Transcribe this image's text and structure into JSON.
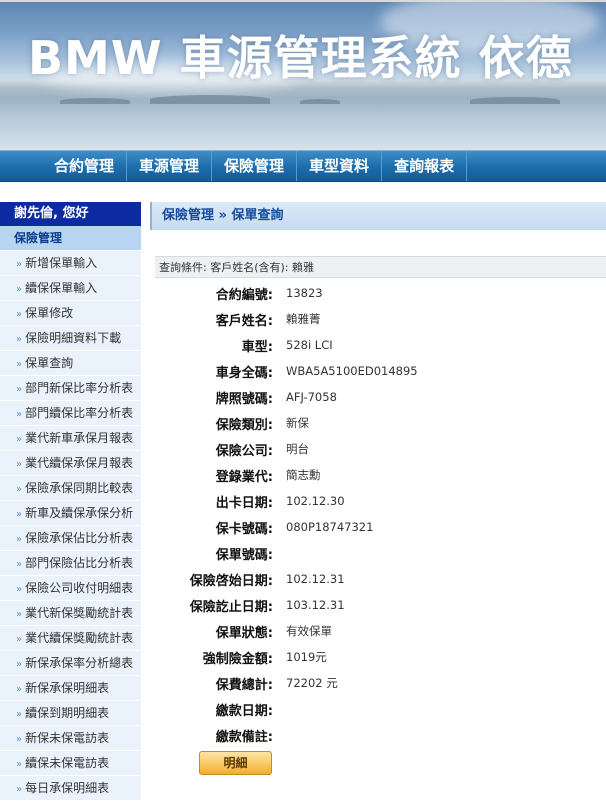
{
  "banner": {
    "title": "BMW 車源管理系統 依德"
  },
  "nav": {
    "items": [
      "合約管理",
      "車源管理",
      "保險管理",
      "車型資料",
      "查詢報表"
    ]
  },
  "sidebar": {
    "greeting": "謝先倫, 您好",
    "section": "保險管理",
    "items": [
      "新增保單輸入",
      "續保保單輸入",
      "保單修改",
      "保險明細資料下載",
      "保單查詢",
      "部門新保比率分析表",
      "部門續保比率分析表",
      "業代新車承保月報表",
      "業代續保承保月報表",
      "保險承保同期比較表",
      "新車及續保承保分析",
      "保險承保佔比分析表",
      "部門保險佔比分析表",
      "保險公司收付明細表",
      "業代新保獎勵統計表",
      "業代續保獎勵統計表",
      "新保承保率分析總表",
      "新保承保明細表",
      "續保到期明細表",
      "新保未保電訪表",
      "續保未保電訪表",
      "每日承保明細表"
    ]
  },
  "content": {
    "breadcrumb": "保險管理 » 保單查詢",
    "query": "查詢條件:  客戶姓名(含有): 賴雅",
    "fields": [
      {
        "label": "合約編號:",
        "value": "13823"
      },
      {
        "label": "客戶姓名:",
        "value": "賴雅菁"
      },
      {
        "label": "車型:",
        "value": "528i LCI"
      },
      {
        "label": "車身全碼:",
        "value": "WBA5A5100ED014895"
      },
      {
        "label": "牌照號碼:",
        "value": "AFJ-7058"
      },
      {
        "label": "保險類別:",
        "value": "新保"
      },
      {
        "label": "保險公司:",
        "value": "明台"
      },
      {
        "label": "登錄業代:",
        "value": "簡志勳"
      },
      {
        "label": "出卡日期:",
        "value": "102.12.30"
      },
      {
        "label": "保卡號碼:",
        "value": "080P18747321"
      },
      {
        "label": "保單號碼:",
        "value": ""
      },
      {
        "label": "保險啓始日期:",
        "value": "102.12.31"
      },
      {
        "label": "保險訖止日期:",
        "value": "103.12.31"
      },
      {
        "label": "保單狀態:",
        "value": "有效保單"
      },
      {
        "label": "強制險金額:",
        "value": "1019元"
      },
      {
        "label": "保費總計:",
        "value": "72202 元"
      },
      {
        "label": "繳款日期:",
        "value": ""
      },
      {
        "label": "繳款備註:",
        "value": ""
      }
    ],
    "detail_button": "明細"
  }
}
